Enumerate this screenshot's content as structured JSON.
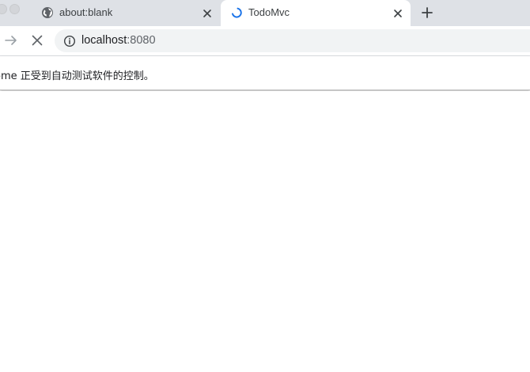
{
  "tabs": [
    {
      "title": "about:blank",
      "icon": "globe-icon",
      "active": false
    },
    {
      "title": "TodoMvc",
      "icon": "loading-spinner-icon",
      "active": true
    }
  ],
  "new_tab_icon": "plus-icon",
  "toolbar": {
    "forward_icon": "arrow-right-icon",
    "stop_icon": "close-icon"
  },
  "omnibox": {
    "icon": "info-icon",
    "host": "localhost",
    "port": ":8080"
  },
  "infobar": {
    "text": "ome 正受到自动测试软件的控制。"
  },
  "colors": {
    "tabstrip_bg": "#dee1e6",
    "spinner": "#1a73e8",
    "omnibox_bg": "#f1f3f4"
  }
}
